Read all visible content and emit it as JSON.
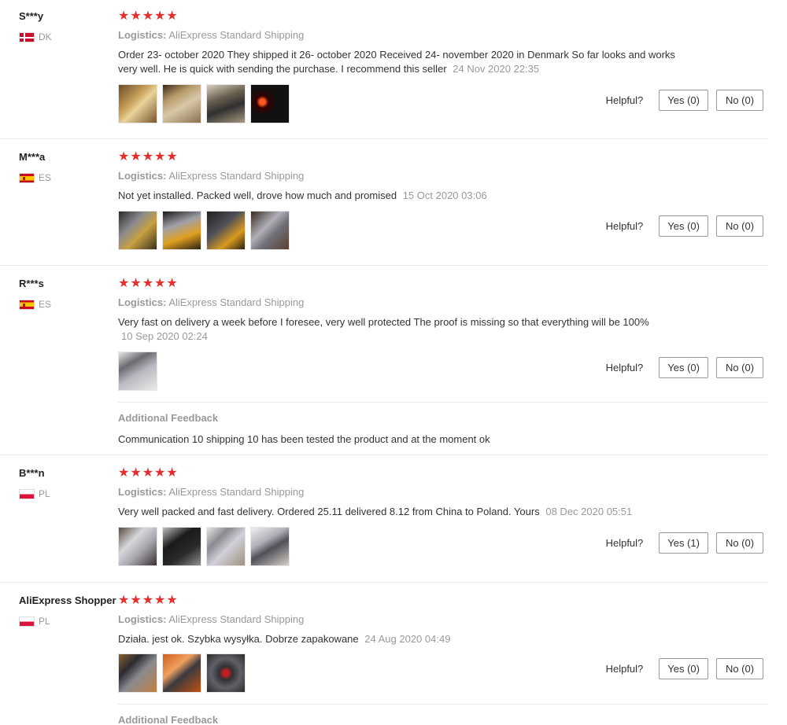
{
  "helpful_label": "Helpful?",
  "logistics_label": "Logistics:",
  "stars": "★★★★★",
  "additional_feedback_title": "Additional Feedback",
  "colors": {
    "star": "#e62e2e",
    "muted": "#999999",
    "text": "#333333"
  },
  "reviews": [
    {
      "user": "S***y",
      "country": "DK",
      "flag": "dk",
      "shipping": "AliExpress Standard Shipping",
      "text": "Order 23- october 2020 They shipped it 26- october 2020 Received 24- november 2020 in Denmark So far looks and works very well. He is quick with sending the purchase. I recommend this seller",
      "date": "24 Nov 2020 22:35",
      "yes": "Yes (0)",
      "no": "No (0)",
      "photos": [
        "box-on-table",
        "silver-plate",
        "device-in-hand",
        "car-dashboard"
      ]
    },
    {
      "user": "M***a",
      "country": "ES",
      "flag": "es",
      "shipping": "AliExpress Standard Shipping",
      "text": "Not yet installed. Packed well, drove how much and promised",
      "date": "15 Oct 2020 03:06",
      "yes": "Yes (0)",
      "no": "No (0)",
      "photos": [
        "package-1",
        "package-2",
        "package-3",
        "package-4"
      ]
    },
    {
      "user": "R***s",
      "country": "ES",
      "flag": "es",
      "shipping": "AliExpress Standard Shipping",
      "text": "Very fast on delivery a week before I foresee, very well protected The proof is missing so that everything will be 100%",
      "date": "10 Sep 2020 02:24",
      "yes": "Yes (0)",
      "no": "No (0)",
      "photos": [
        "device-photo"
      ],
      "additional": "Communication 10 shipping 10 has been tested the product and at the moment ok"
    },
    {
      "user": "B***n",
      "country": "PL",
      "flag": "pl",
      "shipping": "AliExpress Standard Shipping",
      "text": "Very well packed and fast delivery. Ordered 25.11 delivered 8.12 from China to Poland. Yours",
      "date": "08 Dec 2020 05:51",
      "yes": "Yes (1)",
      "no": "No (0)",
      "photos": [
        "silver-panel",
        "black-panel",
        "packaged-panel",
        "wrapped-panel"
      ]
    },
    {
      "user": "AliExpress Shopper",
      "country": "PL",
      "flag": "pl",
      "shipping": "AliExpress Standard Shipping",
      "text": "Działa. jest ok. Szybka wysyłka. Dobrze zapakowane",
      "date": "24 Aug 2020 04:49",
      "yes": "Yes (0)",
      "no": "No (0)",
      "photos": [
        "box-photo",
        "orange-box",
        "car-console"
      ]
    }
  ]
}
